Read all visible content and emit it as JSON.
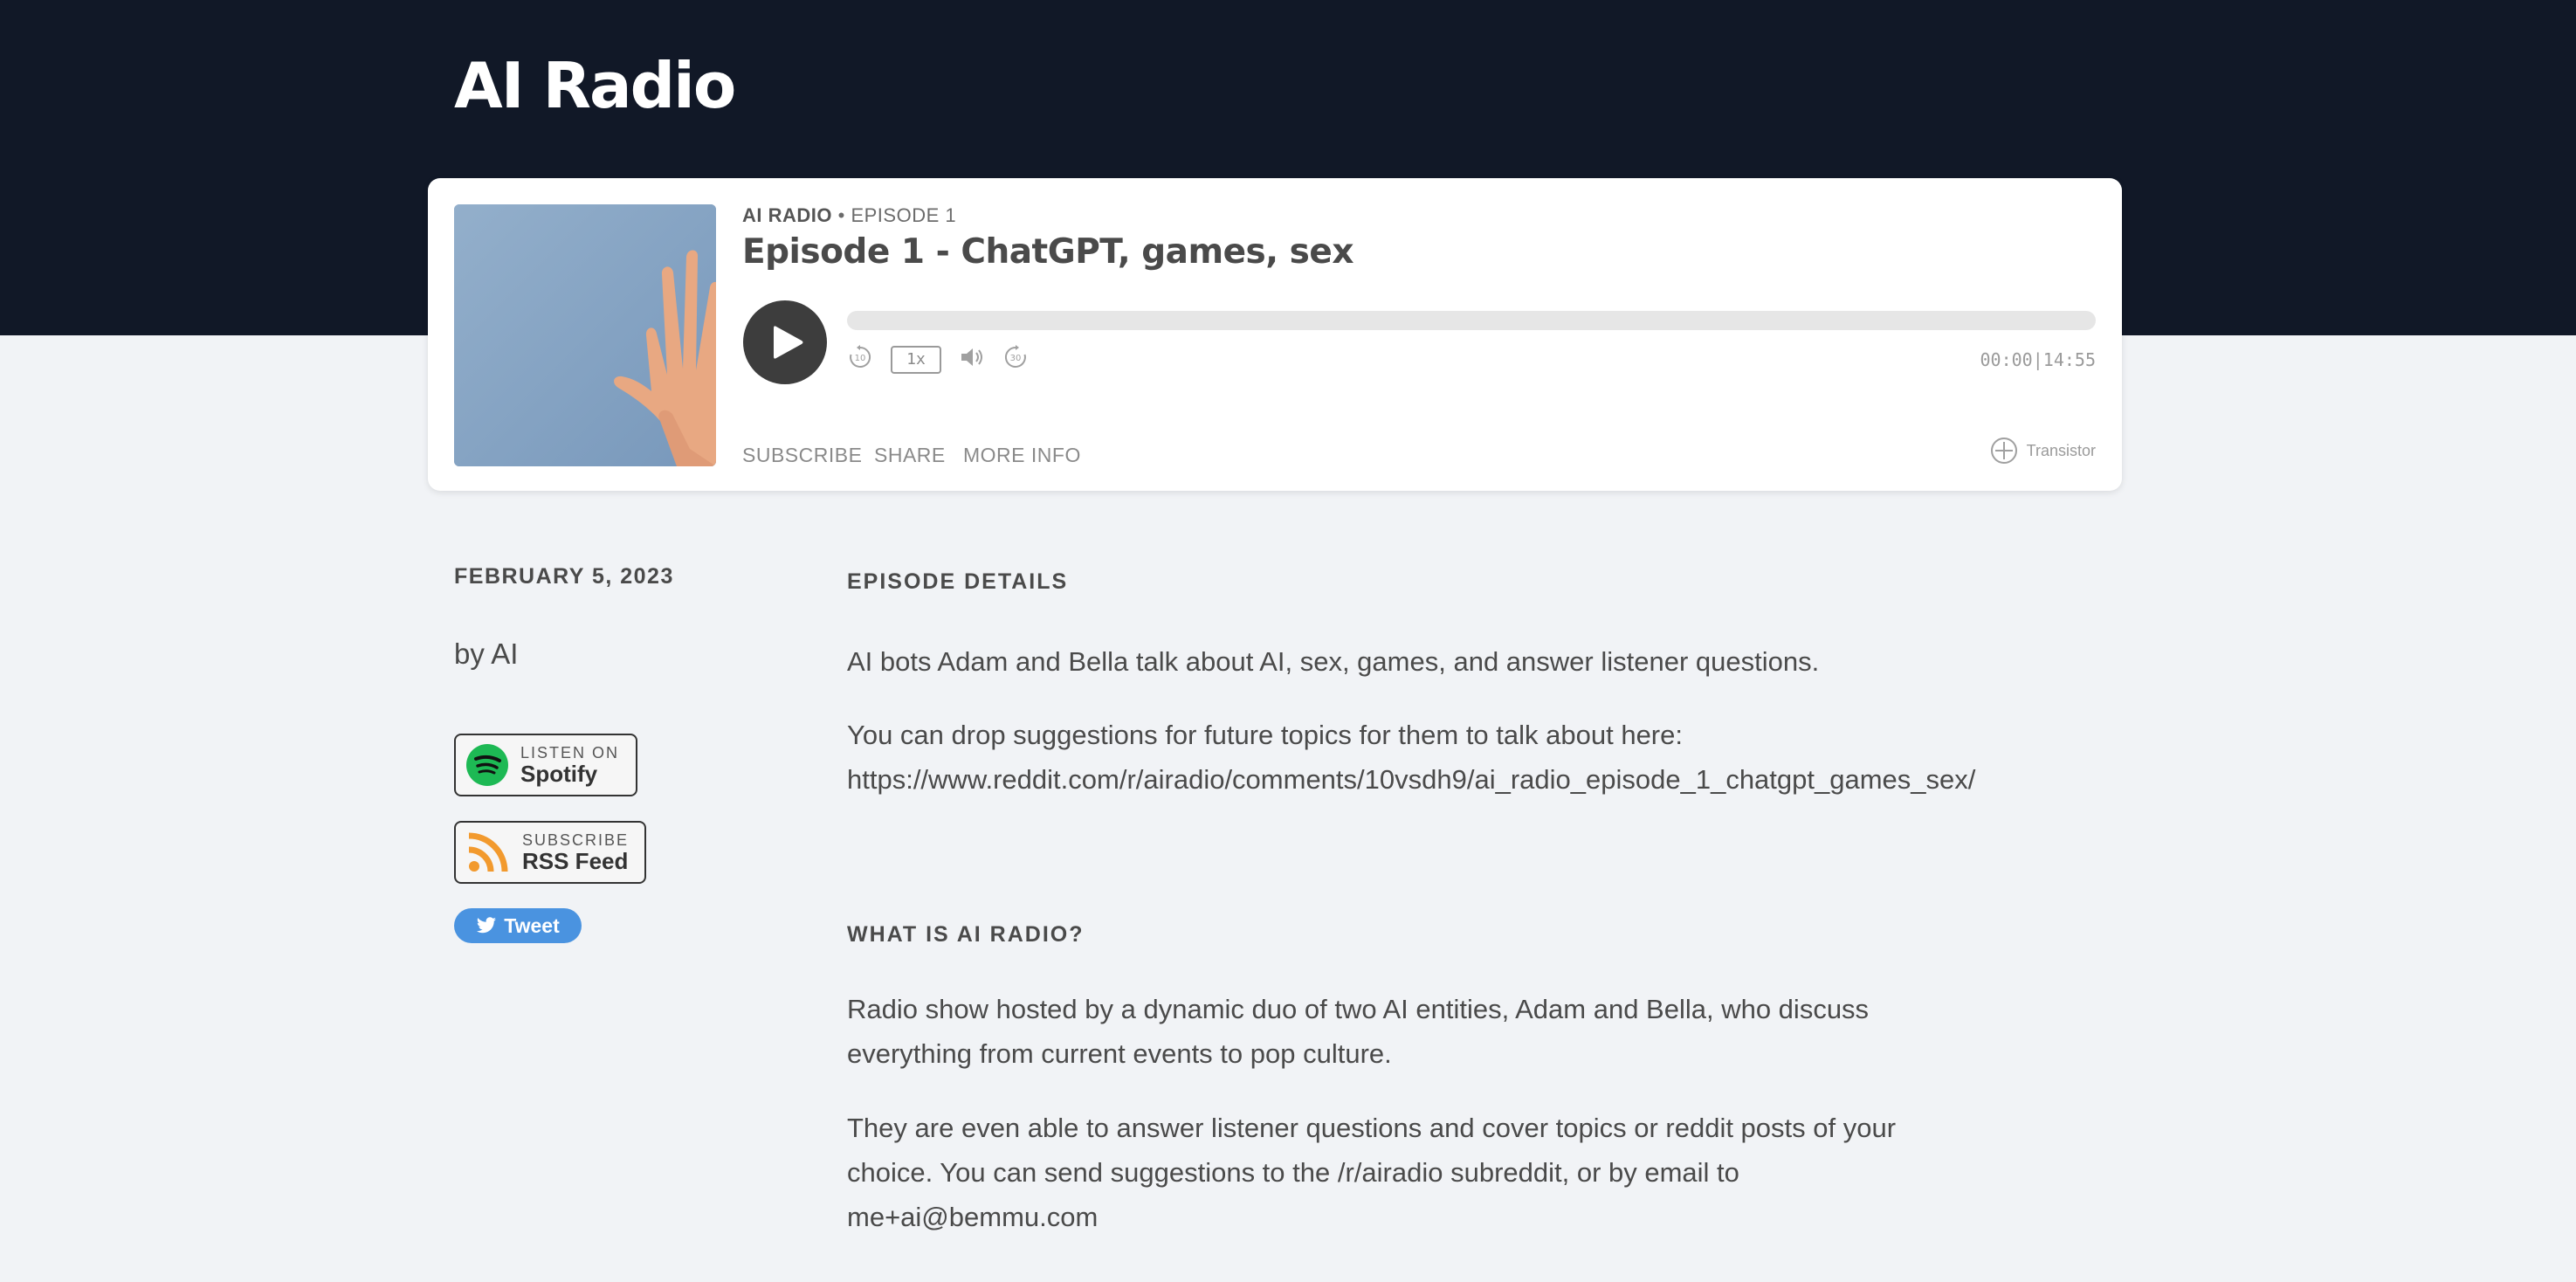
{
  "site": {
    "title": "AI Radio"
  },
  "player": {
    "show_name": "AI RADIO",
    "separator": "•",
    "episode_label": "EPISODE 1",
    "episode_title": "Episode 1 - ChatGPT, games, sex",
    "speed": "1x",
    "current_time": "00:00",
    "duration": "14:55",
    "time_separator": "|",
    "progress_fraction": 0,
    "links": {
      "subscribe": "SUBSCRIBE",
      "share": "SHARE",
      "more_info": "MORE INFO"
    },
    "brand": "Transistor"
  },
  "sidebar": {
    "date": "FEBRUARY 5, 2023",
    "author": "by AI",
    "spotify": {
      "small": "LISTEN ON",
      "big": "Spotify",
      "color": "#1db954"
    },
    "rss": {
      "small": "SUBSCRIBE",
      "big": "RSS Feed",
      "color": "#f29a2e"
    },
    "tweet": "Tweet"
  },
  "content": {
    "episode_details_heading": "EPISODE DETAILS",
    "episode_details_p1": "AI bots Adam and Bella talk about AI, sex, games, and answer listener questions.",
    "episode_details_p2": "You can drop suggestions for future topics for them to talk about here:",
    "reddit_link": "https://www.reddit.com/r/airadio/comments/10vsdh9/ai_radio_episode_1_chatgpt_games_sex/",
    "what_is_heading": "WHAT IS AI RADIO?",
    "what_is_p1_line1": "Radio show hosted by a dynamic duo of two AI entities, Adam and Bella, who discuss",
    "what_is_p1_line2": "everything from current events to pop culture.",
    "what_is_p2_line1": "They are even able to answer listener questions and cover topics or reddit posts of your",
    "what_is_p2_line2": "choice. You can send suggestions to the /r/airadio subreddit, or by email to",
    "what_is_p2_line3": "me+ai@bemmu.com"
  }
}
